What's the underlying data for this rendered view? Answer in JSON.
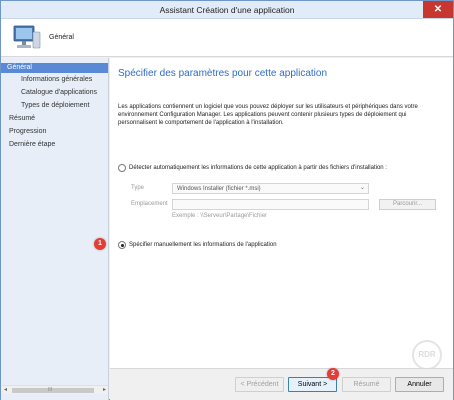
{
  "window": {
    "title": "Assistant Création d'une application",
    "close_glyph": "✕"
  },
  "header": {
    "title": "Général",
    "icon": "computer-icon"
  },
  "sidebar": {
    "items": [
      {
        "label": "Général",
        "level": 0,
        "active": true
      },
      {
        "label": "Informations générales",
        "level": 1,
        "active": false
      },
      {
        "label": "Catalogue d'applications",
        "level": 1,
        "active": false
      },
      {
        "label": "Types de déploiement",
        "level": 1,
        "active": false
      },
      {
        "label": "Résumé",
        "level": 0,
        "active": false
      },
      {
        "label": "Progression",
        "level": 0,
        "active": false
      },
      {
        "label": "Dernière étape",
        "level": 0,
        "active": false
      }
    ],
    "scrollbar": {
      "left_arrow": "◂",
      "right_arrow": "▸",
      "grip": "III"
    }
  },
  "main": {
    "heading": "Spécifier des paramètres pour cette application",
    "description": "Les applications contiennent un logiciel que vous pouvez déployer sur les utilisateurs et périphériques dans votre environnement Configuration Manager. Les applications peuvent contenir plusieurs types de déploiement qui personnalisent le comportement de l'application à l'installation.",
    "auto_detect": {
      "label": "Détecter automatiquement les informations de cette application à partir des fichiers d'installation :",
      "selected": false,
      "type_label": "Type",
      "type_value": "Windows Installer (fichier *.msi)",
      "location_label": "Emplacement",
      "location_value": "",
      "browse_label": "Parcourir...",
      "example": "Exemple : \\\\Serveur\\Partage\\Fichier"
    },
    "manual": {
      "label": "Spécifier manuellement les informations de l'application",
      "selected": true
    }
  },
  "annotations": {
    "badge_1": "1",
    "badge_2": "2"
  },
  "footer": {
    "prev_label": "< Précédent",
    "next_label": "Suivant >",
    "summary_label": "Résumé",
    "cancel_label": "Annuler"
  },
  "watermark": "RDR",
  "colors": {
    "accent": "#2e6cc6",
    "sidebar_active": "#5a8ad6",
    "badge": "#e53c35",
    "close": "#c7372f"
  }
}
